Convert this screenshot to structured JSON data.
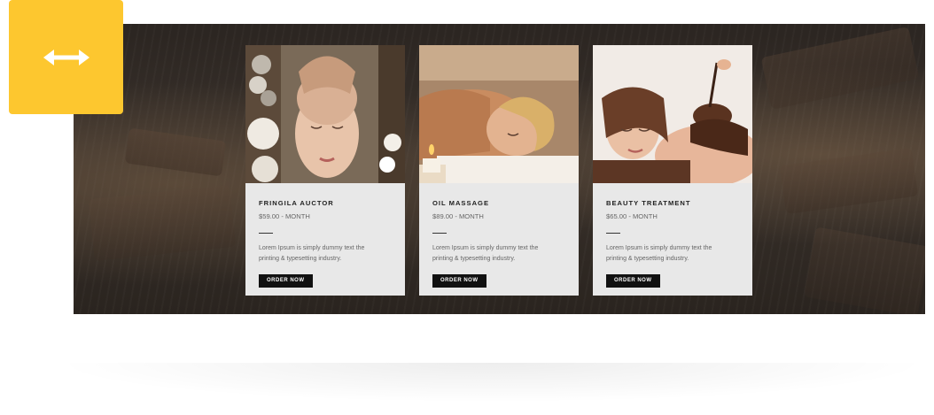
{
  "badge": {
    "icon": "horizontal-resize-arrow-icon",
    "color": "#fdc72f"
  },
  "cards": [
    {
      "title": "FRINGILA AUCTOR",
      "price": "$59.00 - MONTH",
      "description": "Lorem Ipsum is simply dummy text the printing & typesetting industry.",
      "button": "ORDER NOW",
      "photo": "face-massage-photo"
    },
    {
      "title": "OIL MASSAGE",
      "price": "$89.00 - MONTH",
      "description": "Lorem Ipsum is simply dummy text the printing & typesetting industry.",
      "button": "ORDER NOW",
      "photo": "back-massage-photo"
    },
    {
      "title": "BEAUTY TREATMENT",
      "price": "$65.00 - MONTH",
      "description": "Lorem Ipsum is simply dummy text the printing & typesetting industry.",
      "button": "ORDER NOW",
      "photo": "chocolate-treatment-photo"
    }
  ]
}
